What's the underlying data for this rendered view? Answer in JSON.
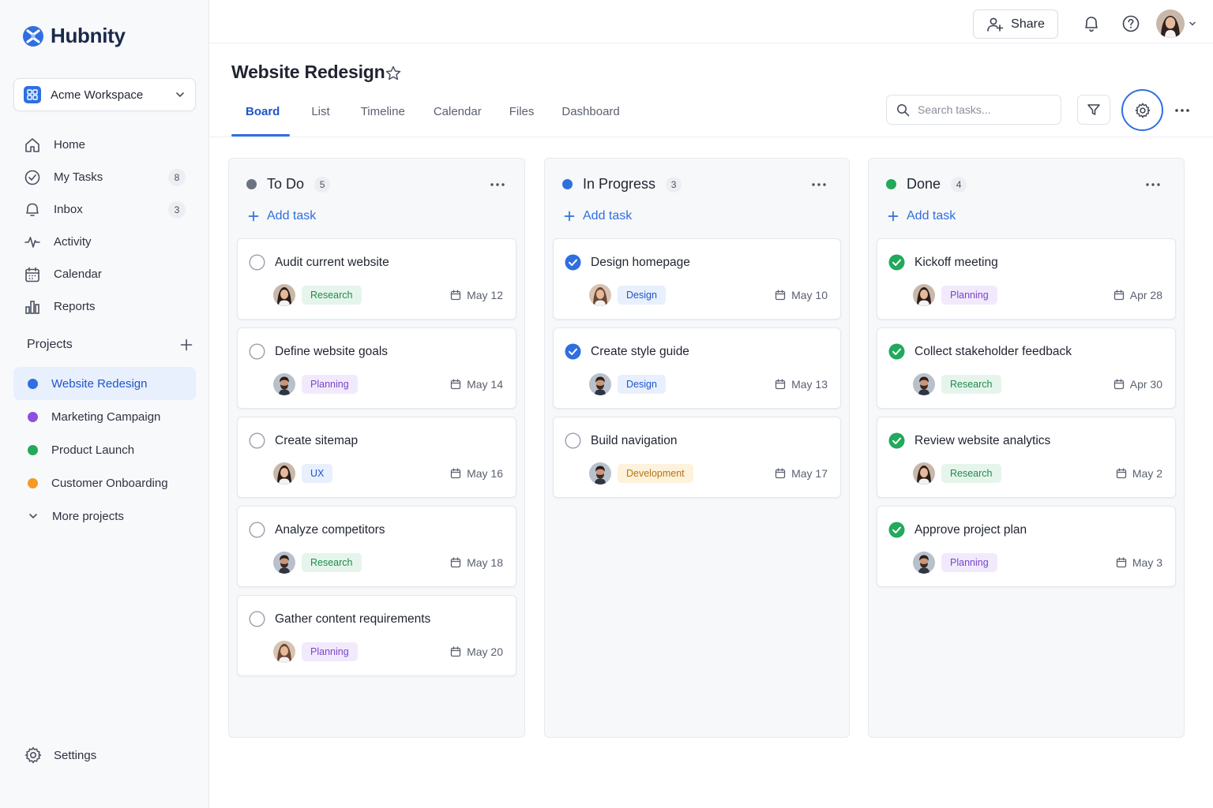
{
  "brand": {
    "name": "Hubnity"
  },
  "workspace": {
    "name": "Acme Workspace"
  },
  "nav": [
    {
      "label": "Home",
      "icon": "home-icon",
      "badge": ""
    },
    {
      "label": "My Tasks",
      "icon": "check-circle-icon",
      "badge": "8"
    },
    {
      "label": "Inbox",
      "icon": "inbox-icon",
      "badge": "3"
    },
    {
      "label": "Activity",
      "icon": "activity-icon",
      "badge": ""
    },
    {
      "label": "Calendar",
      "icon": "calendar-icon",
      "badge": ""
    },
    {
      "label": "Reports",
      "icon": "bar-chart-icon",
      "badge": ""
    }
  ],
  "projects": {
    "title": "Projects",
    "items": [
      {
        "label": "Website Redesign",
        "color": "#2f6fe0",
        "active": true
      },
      {
        "label": "Marketing Campaign",
        "color": "#8b50e0",
        "active": false
      },
      {
        "label": "Product Launch",
        "color": "#22a95c",
        "active": false
      },
      {
        "label": "Customer Onboarding",
        "color": "#f59a23",
        "active": false
      }
    ],
    "more_label": "More projects"
  },
  "settings_label": "Settings",
  "topbar": {
    "share_label": "Share"
  },
  "page": {
    "title": "Website Redesign",
    "tabs": [
      "Board",
      "List",
      "Timeline",
      "Calendar",
      "Files",
      "Dashboard"
    ],
    "active_tab": "Board",
    "search_placeholder": "Search tasks..."
  },
  "colors": {
    "accent": "#2f6fe0",
    "todo": "#6b7280",
    "in_progress": "#2f6fe0",
    "done": "#22a95c"
  },
  "board": {
    "add_task_label": "Add task",
    "columns": [
      {
        "title": "To Do",
        "count": "5",
        "status": "todo",
        "cards": [
          {
            "title": "Audit current website",
            "tag": "Research",
            "tag_kind": "research",
            "date": "May 12",
            "avatar": "woman",
            "done": false
          },
          {
            "title": "Define website goals",
            "tag": "Planning",
            "tag_kind": "planning",
            "date": "May 14",
            "avatar": "man",
            "done": false
          },
          {
            "title": "Create sitemap",
            "tag": "UX",
            "tag_kind": "ux",
            "date": "May 16",
            "avatar": "woman",
            "done": false
          },
          {
            "title": "Analyze competitors",
            "tag": "Research",
            "tag_kind": "research",
            "date": "May 18",
            "avatar": "man",
            "done": false
          },
          {
            "title": "Gather content requirements",
            "tag": "Planning",
            "tag_kind": "planning",
            "date": "May 20",
            "avatar": "woman2",
            "done": false
          }
        ]
      },
      {
        "title": "In Progress",
        "count": "3",
        "status": "in_progress",
        "cards": [
          {
            "title": "Design homepage",
            "tag": "Design",
            "tag_kind": "design",
            "date": "May 10",
            "avatar": "woman2",
            "done": "blue"
          },
          {
            "title": "Create style guide",
            "tag": "Design",
            "tag_kind": "design",
            "date": "May 13",
            "avatar": "man",
            "done": "blue"
          },
          {
            "title": "Build navigation",
            "tag": "Development",
            "tag_kind": "development",
            "date": "May 17",
            "avatar": "man",
            "done": false
          }
        ]
      },
      {
        "title": "Done",
        "count": "4",
        "status": "done",
        "cards": [
          {
            "title": "Kickoff meeting",
            "tag": "Planning",
            "tag_kind": "planning",
            "date": "Apr 28",
            "avatar": "woman",
            "done": "green"
          },
          {
            "title": "Collect stakeholder feedback",
            "tag": "Research",
            "tag_kind": "research",
            "date": "Apr 30",
            "avatar": "man",
            "done": "green"
          },
          {
            "title": "Review website analytics",
            "tag": "Research",
            "tag_kind": "research",
            "date": "May 2",
            "avatar": "woman",
            "done": "green"
          },
          {
            "title": "Approve project plan",
            "tag": "Planning",
            "tag_kind": "planning",
            "date": "May 3",
            "avatar": "man",
            "done": "green"
          }
        ]
      }
    ]
  }
}
